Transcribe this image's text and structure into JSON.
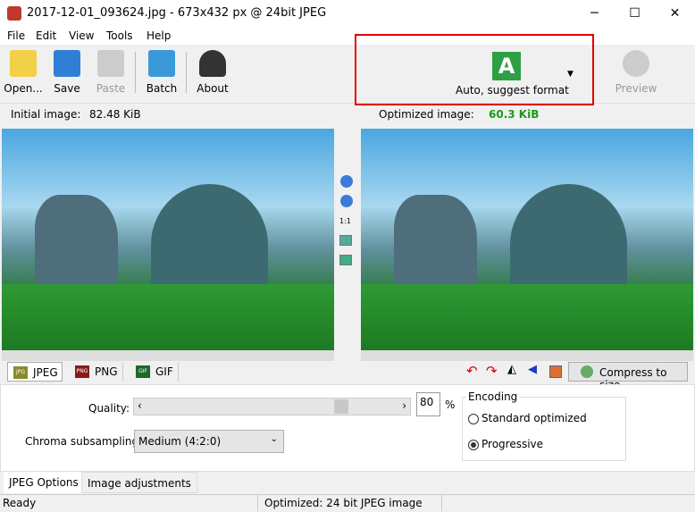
{
  "window": {
    "title": "2017-12-01_093624.jpg - 673x432 px @ 24bit JPEG",
    "minimize": "─",
    "maximize": "☐",
    "close": "✕"
  },
  "menu": [
    "File",
    "Edit",
    "View",
    "Tools",
    "Help"
  ],
  "toolbar": {
    "open": "Open...",
    "save": "Save",
    "paste": "Paste",
    "batch": "Batch",
    "about": "About",
    "format": "Auto, suggest format",
    "format_icon_letter": "A",
    "preview": "Preview"
  },
  "info": {
    "initial_label": "Initial image:",
    "initial_size": "82.48 KiB",
    "optimized_label": "Optimized image:",
    "optimized_size": "60.3 KiB",
    "optimized_color": "#1a9a1a"
  },
  "zoom": {
    "one_to_one": "1:1"
  },
  "formats": [
    {
      "label": "JPEG",
      "icon": "JPG"
    },
    {
      "label": "PNG",
      "icon": "PNG"
    },
    {
      "label": "GIF",
      "icon": "GIF"
    }
  ],
  "actions": {
    "compress": "Compress to size"
  },
  "options": {
    "quality_label": "Quality:",
    "quality_value": "80",
    "quality_unit": "%",
    "quality_percent": 80,
    "chroma_label": "Chroma subsampling:",
    "chroma_value": "Medium (4:2:0)",
    "encoding_title": "Encoding",
    "enc_standard": "Standard optimized",
    "enc_progressive": "Progressive",
    "selected": "Progressive"
  },
  "bottom_tabs": [
    "JPEG Options",
    "Image adjustments"
  ],
  "status": {
    "left": "Ready",
    "middle": "Optimized: 24 bit JPEG image"
  }
}
